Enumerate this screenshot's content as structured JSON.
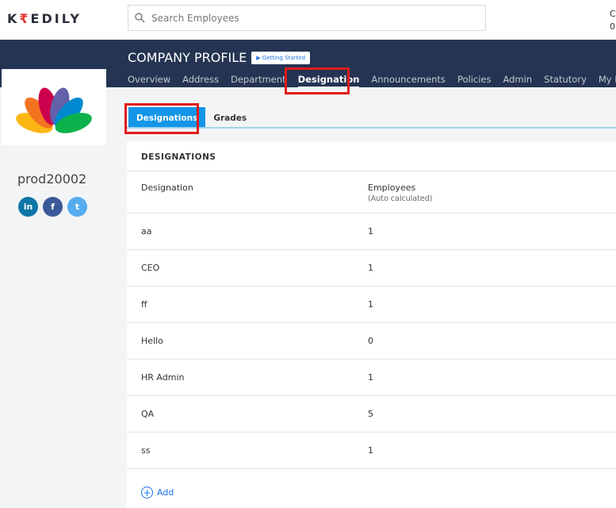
{
  "brand": {
    "logo_left": "K",
    "logo_mid": "₹",
    "logo_right": "EDILY"
  },
  "search": {
    "placeholder": "Search Employees"
  },
  "user": {
    "line1": "C",
    "line2": "0"
  },
  "header": {
    "title": "COMPANY PROFILE",
    "getting_started": "▶ Getting Started",
    "nav": [
      "Overview",
      "Address",
      "Department",
      "Designation",
      "Announcements",
      "Policies",
      "Admin",
      "Statutory",
      "My Plan"
    ],
    "active": "Designation"
  },
  "company": {
    "name": "prod20002",
    "social": [
      "in",
      "f",
      "t"
    ]
  },
  "subtabs": [
    "Designations",
    "Grades"
  ],
  "table": {
    "title": "DESIGNATIONS",
    "col1": "Designation",
    "col2": "Employees",
    "col2_sub": "(Auto calculated)",
    "rows": [
      {
        "name": "aa",
        "count": "1"
      },
      {
        "name": "CEO",
        "count": "1"
      },
      {
        "name": "ff",
        "count": "1"
      },
      {
        "name": "Hello",
        "count": "0"
      },
      {
        "name": "HR Admin",
        "count": "1"
      },
      {
        "name": "QA",
        "count": "5"
      },
      {
        "name": "ss",
        "count": "1"
      }
    ]
  },
  "add_label": "Add",
  "colors": {
    "header": "#243452",
    "accent": "#1496e8",
    "highlight": "#e01b1b"
  }
}
